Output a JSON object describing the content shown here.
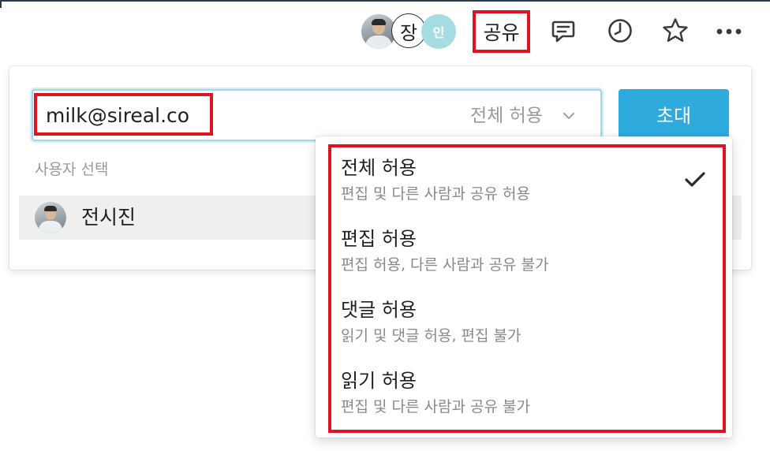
{
  "topbar": {
    "avatar_letter": "장",
    "avatar_initial": "인",
    "share_label": "공유",
    "icons": [
      "comment-icon",
      "history-clock-icon",
      "star-icon",
      "more-icon"
    ]
  },
  "share_panel": {
    "email_value": "milk@sireal.co",
    "permission_selected": "전체 허용",
    "invite_label": "초대",
    "section_label": "사용자 선택",
    "users": [
      {
        "name": "전시진"
      }
    ]
  },
  "permission_menu": {
    "options": [
      {
        "title": "전체 허용",
        "description": "편집 및 다른 사람과 공유 허용",
        "selected": true
      },
      {
        "title": "편집 허용",
        "description": "편집 허용, 다른 사람과 공유 불가",
        "selected": false
      },
      {
        "title": "댓글 허용",
        "description": "읽기 및 댓글 허용, 편집 불가",
        "selected": false
      },
      {
        "title": "읽기 허용",
        "description": "편집 및 다른 사람과 공유 불가",
        "selected": false
      }
    ]
  },
  "colors": {
    "highlight": "#e0141e",
    "invite_button": "#2eaadc",
    "input_focus_border": "#a7d6ec",
    "initial_avatar": "#a6dde2",
    "muted_text": "#9b9a97"
  }
}
